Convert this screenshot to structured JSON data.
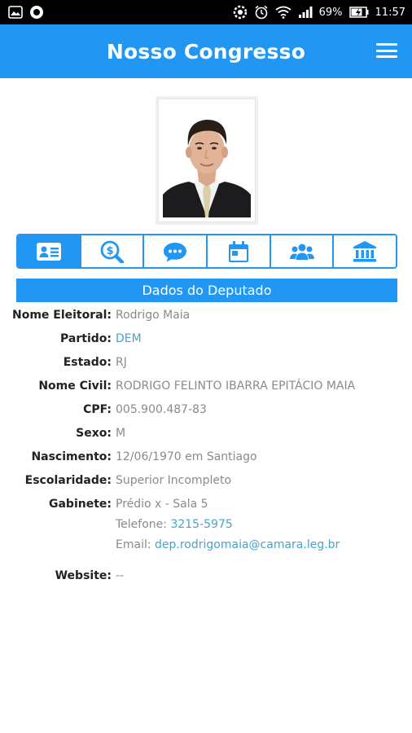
{
  "status_bar": {
    "battery_percent": "69%",
    "time": "11:57"
  },
  "app_bar": {
    "title": "Nosso Congresso"
  },
  "tabs": [
    {
      "icon": "id-card-icon",
      "active": true
    },
    {
      "icon": "money-search-icon",
      "active": false
    },
    {
      "icon": "chat-icon",
      "active": false
    },
    {
      "icon": "calendar-icon",
      "active": false
    },
    {
      "icon": "group-icon",
      "active": false
    },
    {
      "icon": "bank-icon",
      "active": false
    }
  ],
  "section": {
    "title": "Dados do Deputado"
  },
  "details": {
    "nome_eleitoral": {
      "label": "Nome Eleitoral:",
      "value": "Rodrigo Maia"
    },
    "partido": {
      "label": "Partido:",
      "value": "DEM"
    },
    "estado": {
      "label": "Estado:",
      "value": "RJ"
    },
    "nome_civil": {
      "label": "Nome Civil:",
      "value": "RODRIGO FELINTO IBARRA EPITÁCIO MAIA"
    },
    "cpf": {
      "label": "CPF:",
      "value": "005.900.487-83"
    },
    "sexo": {
      "label": "Sexo:",
      "value": "M"
    },
    "nascimento": {
      "label": "Nascimento:",
      "value": "12/06/1970 em Santiago"
    },
    "escolaridade": {
      "label": "Escolaridade:",
      "value": "Superior Incompleto"
    },
    "gabinete": {
      "label": "Gabinete:",
      "location": "Prédio x - Sala 5",
      "phone_label": "Telefone:",
      "phone": "3215-5975",
      "email_label": "Email:",
      "email": "dep.rodrigomaia@camara.leg.br"
    },
    "website": {
      "label": "Website:",
      "value": "--"
    }
  },
  "colors": {
    "accent": "#2196f3",
    "link": "#4aa3c8",
    "value_text": "#8a8a8a"
  }
}
